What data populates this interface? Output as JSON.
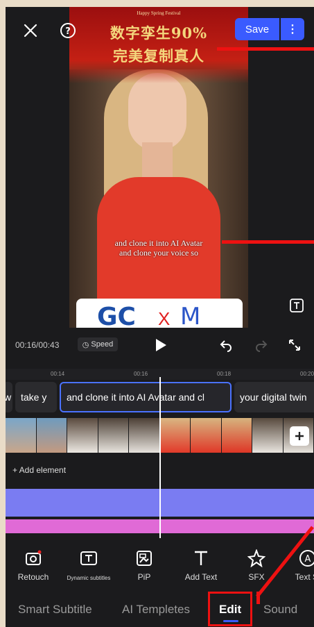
{
  "top_bar": {
    "save_label": "Save",
    "more_label": "⋮"
  },
  "preview": {
    "festival_text": "Happy Spring Festival",
    "headline_line1": "数字孪生90%",
    "headline_line2": "完美复制真人",
    "subtitle_line1": "and clone it into AI Avatar",
    "subtitle_line2": "and clone your voice so",
    "logo_left": "GC",
    "logo_x": "X",
    "logo_right": "M"
  },
  "playback": {
    "time": "00:16/00:43",
    "speed_label": "Speed"
  },
  "ruler": [
    "00:14",
    "00:16",
    "00:18",
    "00:20"
  ],
  "subtitle_clips": [
    "w",
    "take y",
    "and clone it into AI Avatar and cl",
    "your digital twin"
  ],
  "add_element_label": "+ Add element",
  "tools": [
    {
      "label": "Retouch",
      "icon": "retouch-icon"
    },
    {
      "label": "Dynamic subtitles",
      "icon": "dynamic-subtitles-icon"
    },
    {
      "label": "PiP",
      "icon": "pip-icon"
    },
    {
      "label": "Add Text",
      "icon": "text-icon"
    },
    {
      "label": "SFX",
      "icon": "sfx-icon"
    },
    {
      "label": "Text St",
      "icon": "text-style-icon"
    }
  ],
  "tabs": [
    {
      "label": "Smart Subtitle",
      "active": false
    },
    {
      "label": "AI Templetes",
      "active": false
    },
    {
      "label": "Edit",
      "active": true
    },
    {
      "label": "Sound",
      "active": false
    }
  ],
  "colors": {
    "accent": "#3a5bff",
    "annotation": "#ee1111",
    "track_purple": "#7a7cf2",
    "track_pink": "#e06ad6"
  }
}
